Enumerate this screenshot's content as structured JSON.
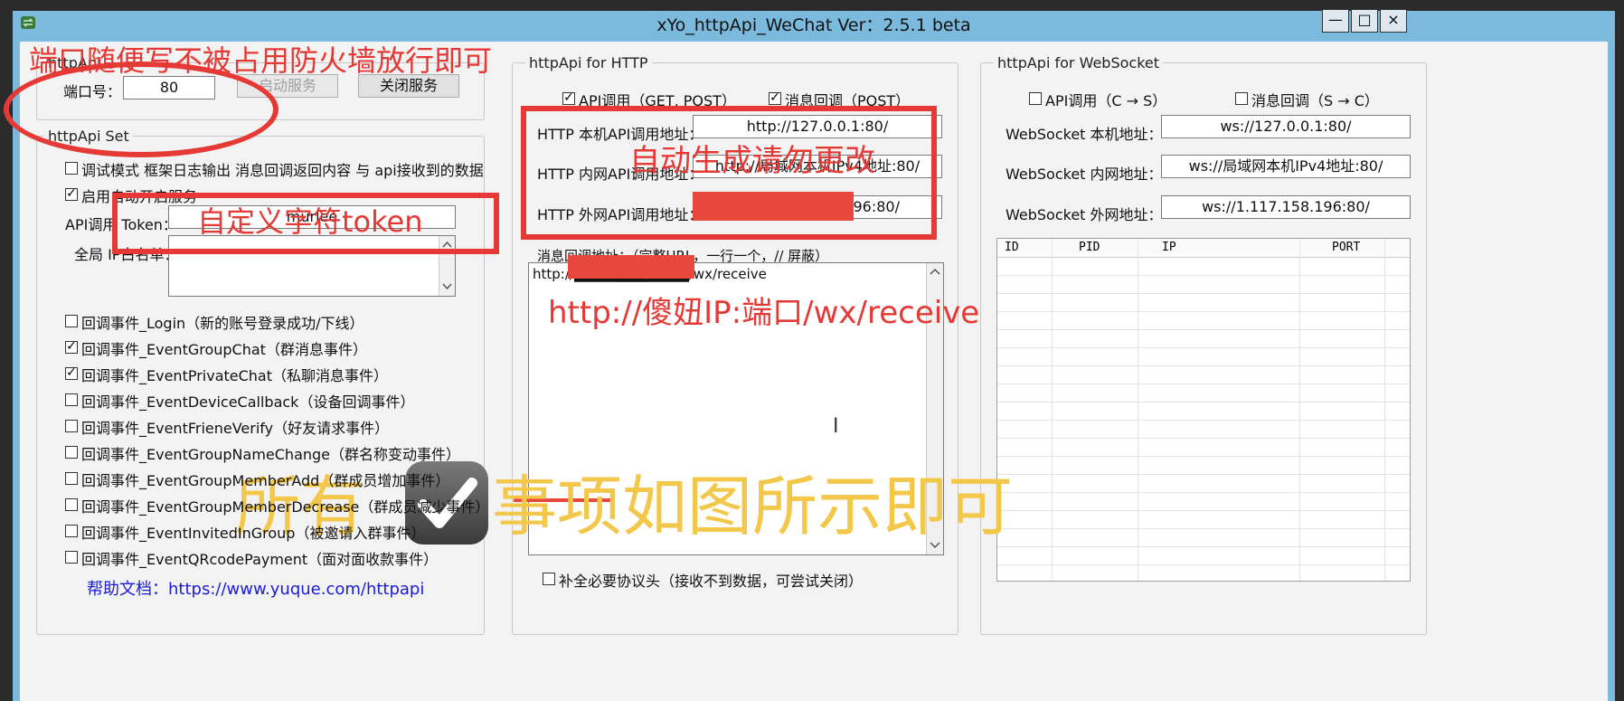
{
  "window": {
    "title": "xYo_httpApi_WeChat   Ver：2.5.1 beta",
    "buttons": {
      "minimize": "—",
      "maximize": "□",
      "close": "×"
    }
  },
  "left_panel": {
    "port_group": {
      "label": "httpApi",
      "port_label": "端口号：",
      "port_value": "80",
      "start_button": "启动服务",
      "stop_button": "关闭服务"
    },
    "set_group": {
      "label": "httpApi Set",
      "debug_mode": "调试模式   框架日志输出 消息回调返回内容 与 api接收到的数据",
      "auto_start": "启用自动开启服务",
      "token_label": "API调用 Token：",
      "token_value": "murlee",
      "whitelist_label": "全局 IP白名单："
    },
    "events": [
      {
        "label": "回调事件_Login（新的账号登录成功/下线）",
        "checked": false
      },
      {
        "label": "回调事件_EventGroupChat（群消息事件）",
        "checked": true
      },
      {
        "label": "回调事件_EventPrivateChat（私聊消息事件）",
        "checked": true
      },
      {
        "label": "回调事件_EventDeviceCallback（设备回调事件）",
        "checked": false
      },
      {
        "label": "回调事件_EventFrieneVerify（好友请求事件）",
        "checked": false
      },
      {
        "label": "回调事件_EventGroupNameChange（群名称变动事件）",
        "checked": false
      },
      {
        "label": "回调事件_EventGroupMemberAdd（群成员增加事件）",
        "checked": false
      },
      {
        "label": "回调事件_EventGroupMemberDecrease（群成员减少事件）",
        "checked": false
      },
      {
        "label": "回调事件_EventInvitedInGroup（被邀请入群事件）",
        "checked": false
      },
      {
        "label": "回调事件_EventQRcodePayment（面对面收款事件）",
        "checked": false
      }
    ],
    "help_link": "帮助文档：https://www.yuque.com/httpapi"
  },
  "http_panel": {
    "label": "httpApi for HTTP",
    "api_call": "API调用（GET, POST）",
    "msg_callback": "消息回调（POST）",
    "local_label": "HTTP 本机API调用地址：",
    "local_value": "http://127.0.0.1:80/",
    "lan_label": "HTTP 内网API调用地址：",
    "lan_value": "http://局域网本机IPv4地址:80/",
    "wan_label": "HTTP 外网API调用地址：",
    "wan_value": "96:80/",
    "callback_label": "消息回调地址：（完整URL，一行一个，// 屏蔽）",
    "callback_text": "http://███████████/wx/receive",
    "complete_header": "补全必要协议头（接收不到数据，可尝试关闭）"
  },
  "ws_panel": {
    "label": "httpApi for WebSocket",
    "api_call": "API调用（C → S）",
    "msg_callback": "消息回调（S → C）",
    "local_label": "WebSocket 本机地址：",
    "local_value": "ws://127.0.0.1:80/",
    "lan_label": "WebSocket 内网地址：",
    "lan_value": "ws://局域网本机IPv4地址:80/",
    "wan_label": "WebSocket 外网地址：",
    "wan_value": "ws://1.117.158.196:80/",
    "table_headers": [
      "ID",
      "PID",
      "IP",
      "PORT"
    ]
  },
  "annotations": {
    "port_note": "端口随便写不被占用防火墙放行即可",
    "auto_note": "自动生成请勿更改",
    "token_note": "自定义字符token",
    "receive_note": "http://傻妞IP:端口/wx/receive",
    "all_note_left": "所有",
    "all_note_right": "事项如图所示即可"
  },
  "colors": {
    "annotation_red": "#e53935",
    "annotation_yellow": "#f3c84a",
    "title_bar": "#7bb9dd",
    "link": "#1a1adb"
  }
}
